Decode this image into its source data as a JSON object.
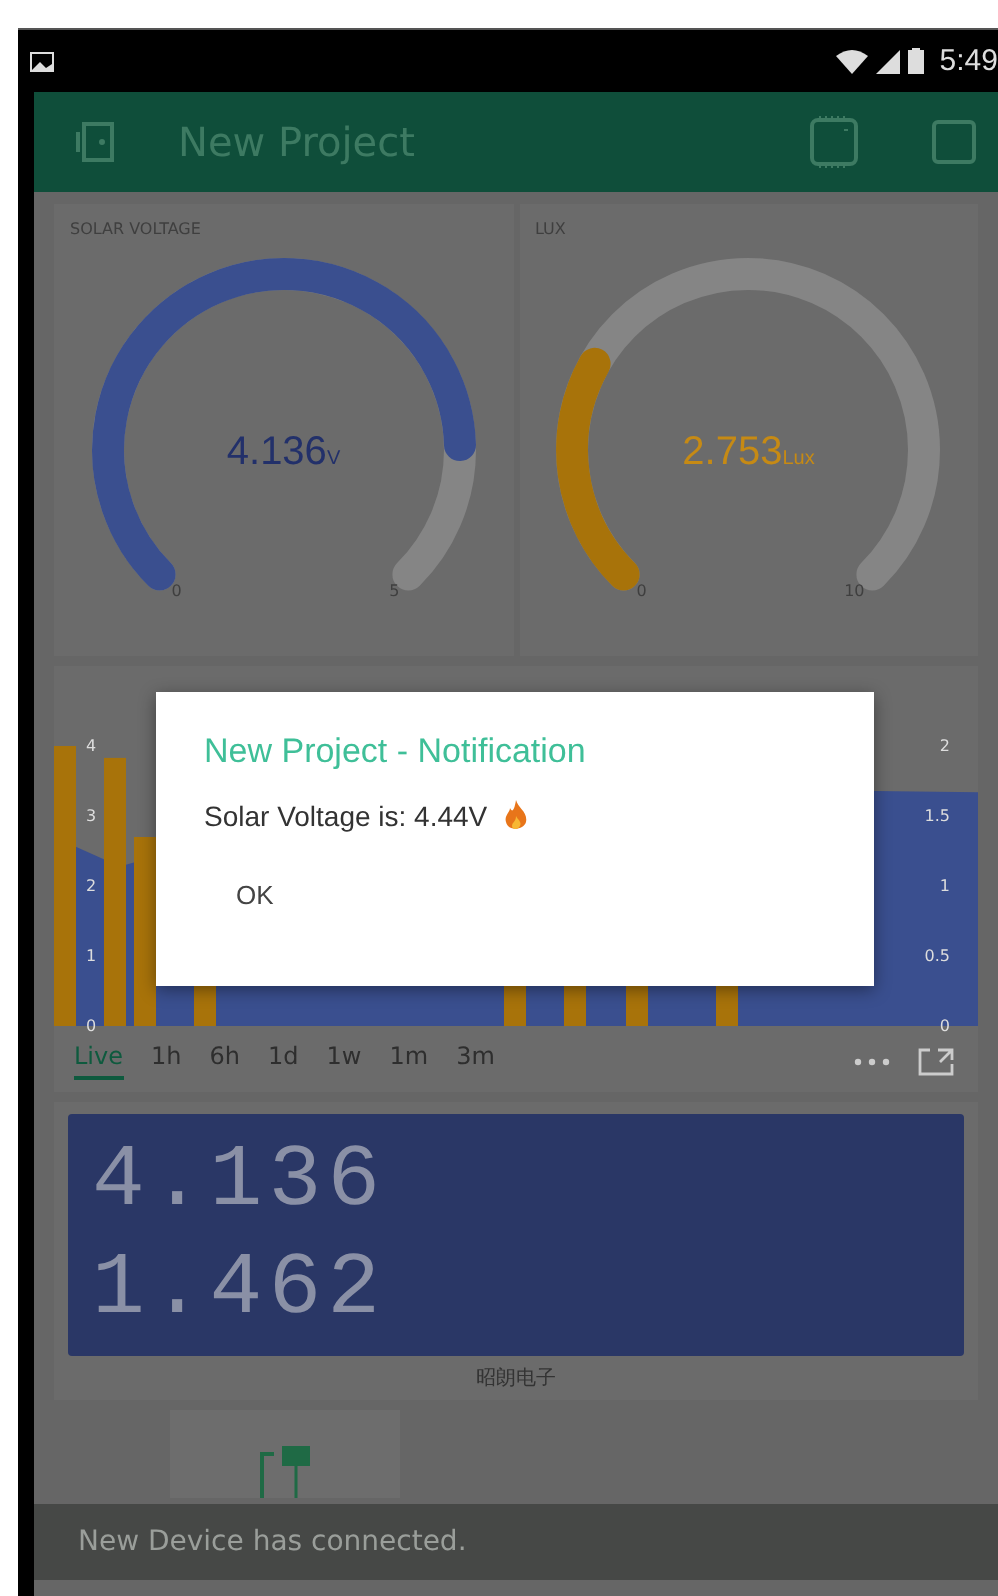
{
  "status_bar": {
    "time": "5:49"
  },
  "app_bar": {
    "title": "New Project"
  },
  "gauges": [
    {
      "label": "SOLAR VOLTAGE",
      "value": "4.136",
      "unit": "V",
      "min": "0",
      "max": "5",
      "color": "#3a4f8f"
    },
    {
      "label": "LUX",
      "value": "2.753",
      "unit": "Lux",
      "min": "0",
      "max": "10",
      "color": "#a8730a"
    }
  ],
  "chart": {
    "left_axis_labels": [
      "4",
      "3",
      "2",
      "1",
      "0"
    ],
    "right_axis_labels": [
      "2",
      "1.5",
      "1",
      "0.5",
      "0"
    ],
    "periods": [
      {
        "label": "Live",
        "selected": true
      },
      {
        "label": "1h",
        "selected": false
      },
      {
        "label": "6h",
        "selected": false
      },
      {
        "label": "1d",
        "selected": false
      },
      {
        "label": "1w",
        "selected": false
      },
      {
        "label": "1m",
        "selected": false
      },
      {
        "label": "3m",
        "selected": false
      }
    ]
  },
  "lcd": {
    "lines": [
      "4.136",
      "1.462"
    ],
    "caption": "昭朗电子"
  },
  "dialog": {
    "title": "New Project - Notification",
    "message": "Solar Voltage is: 4.44V",
    "button": "OK"
  },
  "snackbar": "New Device has connected."
}
